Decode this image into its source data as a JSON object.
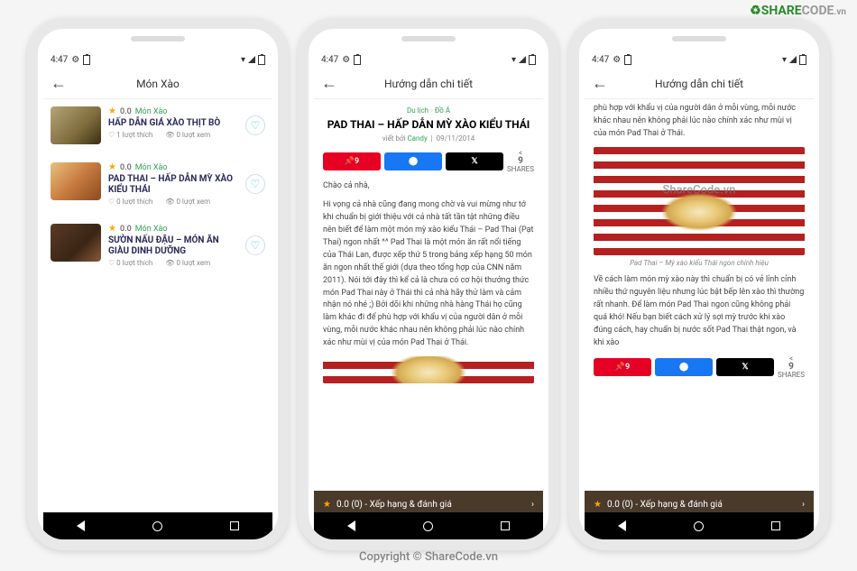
{
  "status": {
    "time": "4:47",
    "gear": "⚙",
    "batt": "▮"
  },
  "screen1": {
    "title": "Món  Xào",
    "items": [
      {
        "rating": "0.0",
        "cat": "Món Xào",
        "title": "HẤP DẪN GIÁ XÀO THỊT BÒ",
        "likes": "1 lượt thích",
        "views": "0 lượt xem"
      },
      {
        "rating": "0.0",
        "cat": "Món Xào",
        "title": "PAD THAI – HẤP DẪN MỲ XÀO KIỂU THÁI",
        "likes": "0 lượt thích",
        "views": "0 lượt xem"
      },
      {
        "rating": "0.0",
        "cat": "Món Xào",
        "title": "SƯỜN NẤU ĐẬU – MÓN ĂN GIÀU DINH DƯỠNG",
        "likes": "0 lượt thích",
        "views": "0 lượt xem"
      }
    ]
  },
  "screen2": {
    "title": "Hướng dẫn chi tiết",
    "crumb1": "Du lịch",
    "crumb2": "Đồ Á",
    "article_title": "PAD THAI – HẤP DẪN MỲ XÀO KIỂU THÁI",
    "by_prefix": "viết bởi ",
    "author": "Candy",
    "date": "09/11/2014",
    "pin": "9",
    "shares_n": "9",
    "shares_t": "SHARES",
    "p1": "Chào cả nhà,",
    "p2": "Hi vọng cả nhà cũng đang mong chờ và vui mừng như tớ khi chuẩn bị giới thiệu với cả nhà tất tần tật những điều nên biết để làm một món mỳ xào kiểu Thái – Pad Thai (Pạt Thai) ngon nhất ^^ Pad Thai là một món ăn rất nổi tiếng của Thái Lan, được xếp thứ 5 trong bảng xếp hạng 50 món ăn ngon nhất thế giới (dựa theo tổng hợp của CNN năm 2011). Nói tới đây thì kể cả là chưa có cơ hội thưởng thức món Pad Thai này ở Thái thì cả nhà hãy thử làm và cảm nhận nó nhé ;) Bởi dõi khi những nhà hàng Thái họ cũng làm khác đi để phù hợp với khẩu vị của người dân ở mỗi vùng, mỗi nước khác nhau nên không phải lúc nào chính xác như mùi vị của món Pad Thai ở Thái.",
    "rating_text": "0.0 (0)  -  Xếp hạng & đánh giá"
  },
  "screen3": {
    "title": "Hướng dẫn chi tiết",
    "p_top": "phù hợp với khẩu vị của người dân ở mỗi vùng, mỗi nước khác nhau nên không phải lúc nào chính xác như mùi vị của món Pad Thai ở Thái.",
    "caption": "Pad Thai – Mỳ xào kiểu Thái ngon chính hiệu",
    "p2": "Về cách làm món mỳ xào này thì chuẩn bị có vẻ lỉnh cỉnh nhiều thứ nguyên liệu nhưng lúc bật bếp lên xào thì thường rất nhanh. Để làm món Pad Thai ngon cũng không phải quá khó! Nếu bạn biết cách xử lý sợi mỳ trước khi xào đúng cách, hay chuẩn bị nước sốt Pad Thai thật ngon, và khi xào",
    "pin": "9",
    "shares_n": "9",
    "shares_t": "SHARES",
    "rating_text": "0.0 (0)  -  Xếp hạng & đánh giá"
  },
  "watermark": {
    "logo1": "SHARE",
    "logo2": "CODE",
    "logo3": ".vn",
    "center": "Copyright © ShareCode.vn",
    "photo": "ShareCode.vn"
  }
}
